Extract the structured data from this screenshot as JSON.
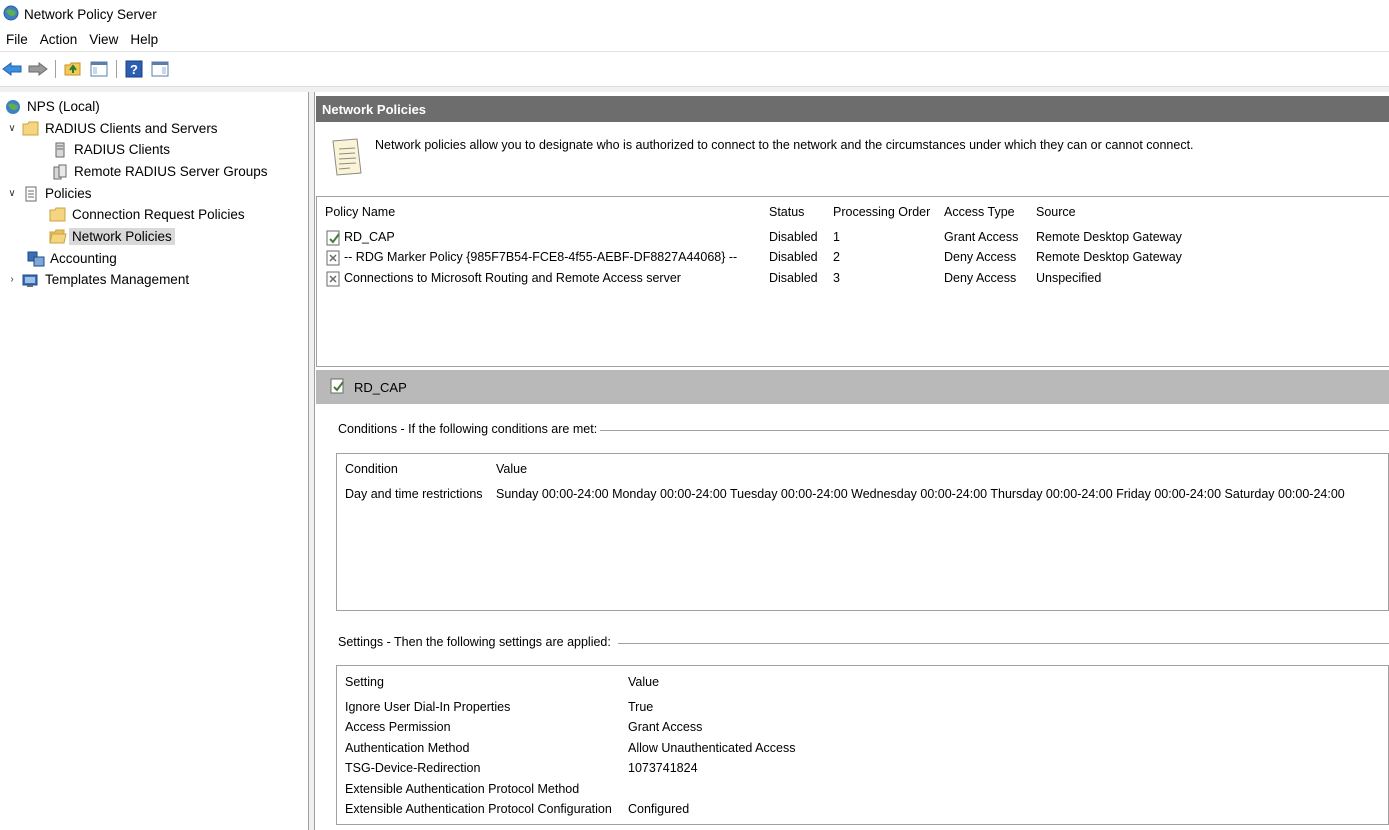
{
  "window": {
    "title": "Network Policy Server"
  },
  "menu": {
    "items": [
      "File",
      "Action",
      "View",
      "Help"
    ]
  },
  "toolbar": {
    "buttons": [
      "back-arrow-icon",
      "forward-arrow-icon",
      "up-folder-icon",
      "show-hide-tree-icon",
      "help-icon",
      "action-pane-icon"
    ]
  },
  "tree": {
    "root": "NPS (Local)",
    "radius_clients_servers": "RADIUS Clients and Servers",
    "radius_clients": "RADIUS Clients",
    "remote_groups": "Remote RADIUS Server Groups",
    "policies": "Policies",
    "connection_request": "Connection Request Policies",
    "network_policies": "Network Policies",
    "accounting": "Accounting",
    "templates": "Templates Management"
  },
  "main": {
    "header": "Network Policies",
    "description": "Network policies allow you to designate who is authorized to connect to the network and the circumstances under which they can or cannot connect.",
    "columns": [
      "Policy Name",
      "Status",
      "Processing Order",
      "Access Type",
      "Source"
    ],
    "policies": [
      {
        "name": "RD_CAP",
        "status": "Disabled",
        "order": "1",
        "access": "Grant Access",
        "source": "Remote Desktop Gateway"
      },
      {
        "name": "-- RDG Marker Policy {985F7B54-FCE8-4f55-AEBF-DF8827A44068} --",
        "status": "Disabled",
        "order": "2",
        "access": "Deny Access",
        "source": "Remote Desktop Gateway"
      },
      {
        "name": "Connections to Microsoft Routing and Remote Access server",
        "status": "Disabled",
        "order": "3",
        "access": "Deny Access",
        "source": "Unspecified"
      }
    ]
  },
  "detail": {
    "title": "RD_CAP",
    "conditions_title": "Conditions - If the following conditions are met:",
    "conditions_columns": [
      "Condition",
      "Value"
    ],
    "conditions": [
      {
        "condition": "Day and time restrictions",
        "value": "Sunday 00:00-24:00 Monday 00:00-24:00 Tuesday 00:00-24:00 Wednesday 00:00-24:00 Thursday 00:00-24:00 Friday 00:00-24:00 Saturday 00:00-24:00"
      }
    ],
    "settings_title": "Settings - Then the following settings are applied:",
    "settings_columns": [
      "Setting",
      "Value"
    ],
    "settings": [
      {
        "setting": "Ignore User Dial-In Properties",
        "value": "True"
      },
      {
        "setting": "Access Permission",
        "value": "Grant Access"
      },
      {
        "setting": "Authentication Method",
        "value": "Allow Unauthenticated Access"
      },
      {
        "setting": "TSG-Device-Redirection",
        "value": "1073741824"
      },
      {
        "setting": "Extensible Authentication Protocol Method",
        "value": ""
      },
      {
        "setting": "Extensible Authentication Protocol Configuration",
        "value": "Configured"
      }
    ]
  }
}
